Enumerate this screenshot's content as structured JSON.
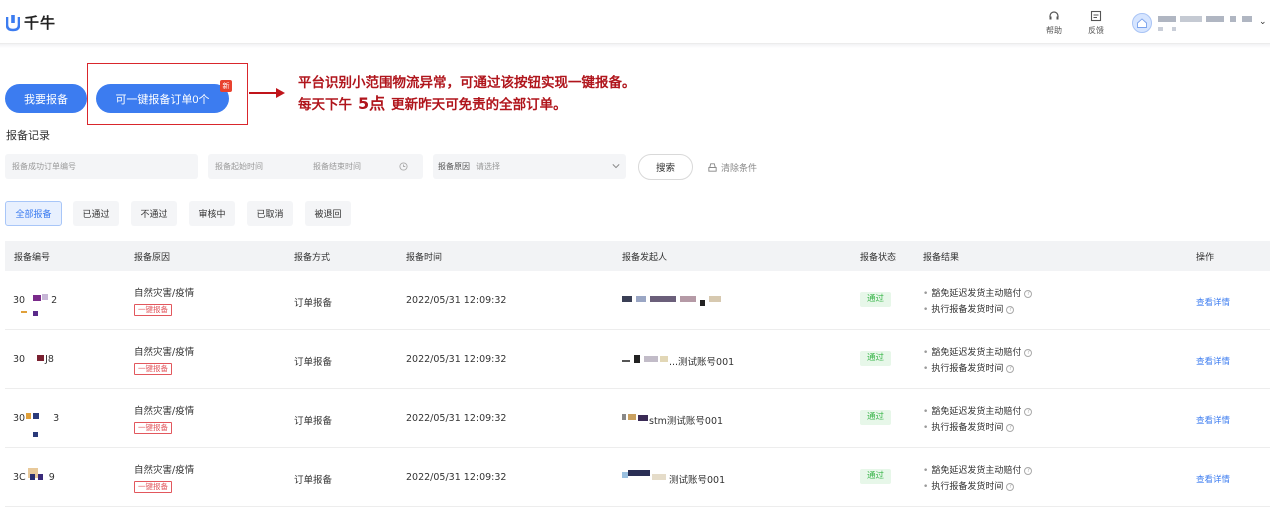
{
  "header": {
    "brand": "千牛",
    "help_label": "帮助",
    "feedback_label": "反馈"
  },
  "actions": {
    "report_button": "我要报备",
    "one_key_button": "可一键报备订单0个",
    "new_badge": "新"
  },
  "annotation": {
    "line1": "平台识别小范围物流异常，可通过该按钮实现一键报备。",
    "line2_prefix": "每天下午",
    "line2_highlight": "5点",
    "line2_suffix": "更新昨天可免责的全部订单。"
  },
  "section_title": "报备记录",
  "filters": {
    "order_placeholder": "报备成功订单编号",
    "start_placeholder": "报备起始时间",
    "end_placeholder": "报备结束时间",
    "reason_label": "报备原因",
    "reason_placeholder": "请选择",
    "search_button": "搜索",
    "clear_label": "清除条件"
  },
  "tabs": [
    {
      "label": "全部报备",
      "active": true
    },
    {
      "label": "已通过"
    },
    {
      "label": "不通过"
    },
    {
      "label": "审核中"
    },
    {
      "label": "已取消"
    },
    {
      "label": "被退回"
    }
  ],
  "table": {
    "columns": [
      "报备编号",
      "报备原因",
      "报备方式",
      "报备时间",
      "报备发起人",
      "报备状态",
      "报备结果",
      "操作"
    ],
    "rows": [
      {
        "id_start": "30",
        "id_end": "2",
        "reason": "自然灾害/疫情",
        "tag": "一键报备",
        "method": "订单报备",
        "time": "2022/05/31 12:09:32",
        "initiator_text": "",
        "status": "通过",
        "result1": "豁免延迟发货主动赔付",
        "result2": "执行报备发货时间",
        "action": "查看详情"
      },
      {
        "id_start": "30",
        "id_end": "J8",
        "reason": "自然灾害/疫情",
        "tag": "一键报备",
        "method": "订单报备",
        "time": "2022/05/31 12:09:32",
        "initiator_text": "...测试账号001",
        "status": "通过",
        "result1": "豁免延迟发货主动赔付",
        "result2": "执行报备发货时间",
        "action": "查看详情"
      },
      {
        "id_start": "30",
        "id_end": "3",
        "reason": "自然灾害/疫情",
        "tag": "一键报备",
        "method": "订单报备",
        "time": "2022/05/31 12:09:32",
        "initiator_text": "stm测试账号001",
        "status": "通过",
        "result1": "豁免延迟发货主动赔付",
        "result2": "执行报备发货时间",
        "action": "查看详情"
      },
      {
        "id_start": "3C",
        "id_end": "9",
        "reason": "自然灾害/疫情",
        "tag": "一键报备",
        "method": "订单报备",
        "time": "2022/05/31 12:09:32",
        "initiator_text": "测试账号001",
        "status": "通过",
        "result1": "豁免延迟发货主动赔付",
        "result2": "执行报备发货时间",
        "action": "查看详情"
      }
    ]
  },
  "colors": {
    "primary": "#3c7cf0",
    "annotation_red": "#b0151c",
    "pass_green": "#3ab54a"
  }
}
